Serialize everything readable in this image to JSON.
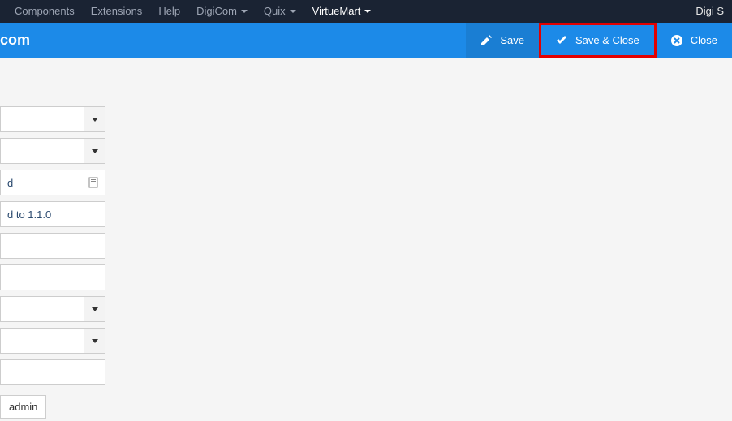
{
  "topnav": {
    "items": [
      {
        "label": "Components",
        "dropdown": false
      },
      {
        "label": "Extensions",
        "dropdown": false
      },
      {
        "label": "Help",
        "dropdown": false
      },
      {
        "label": "DigiCom",
        "dropdown": true
      },
      {
        "label": "Quix",
        "dropdown": true
      },
      {
        "label": "VirtueMart",
        "dropdown": true,
        "active": true
      }
    ],
    "right": "Digi S"
  },
  "bluebar": {
    "title": "com",
    "actions": {
      "save": "Save",
      "save_close": "Save & Close",
      "close": "Close"
    }
  },
  "form": {
    "row3_text": "d",
    "row4_text": "d to 1.1.0",
    "admin_chip": "admin"
  }
}
